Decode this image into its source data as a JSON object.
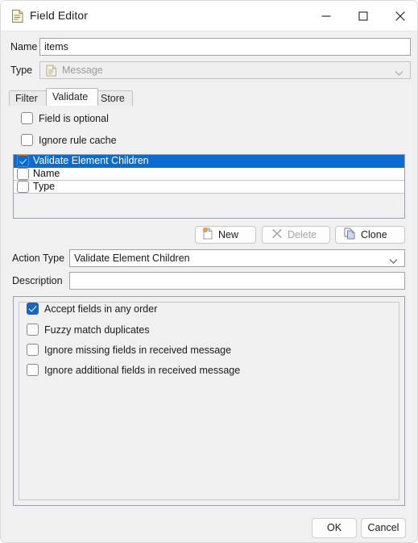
{
  "window": {
    "title": "Field Editor",
    "icon": "document-icon",
    "controls": {
      "minimize": "minimize-icon",
      "maximize": "maximize-icon",
      "close": "close-icon"
    }
  },
  "form": {
    "name_label": "Name",
    "name_value": "items",
    "type_label": "Type",
    "type_value": "Message",
    "type_icon": "document-icon",
    "type_disabled": true
  },
  "tabs": [
    {
      "label": "Filter",
      "active": false
    },
    {
      "label": "Validate",
      "active": true
    },
    {
      "label": "Store",
      "active": false
    }
  ],
  "options": [
    {
      "label": "Field is optional",
      "checked": false
    },
    {
      "label": "Ignore rule cache",
      "checked": false
    }
  ],
  "rules_list": [
    {
      "label": "Validate Element Children",
      "checked": true,
      "selected": true
    },
    {
      "label": "Name",
      "checked": false,
      "selected": false
    },
    {
      "label": "Type",
      "checked": false,
      "selected": false
    }
  ],
  "list_buttons": [
    {
      "label": "New",
      "icon": "new-document-icon",
      "disabled": false
    },
    {
      "label": "Delete",
      "icon": "delete-x-icon",
      "disabled": true
    },
    {
      "label": "Clone",
      "icon": "clone-documents-icon",
      "disabled": false
    }
  ],
  "action": {
    "type_label": "Action Type",
    "type_value": "Validate Element Children",
    "description_label": "Description",
    "description_value": "",
    "description_placeholder": ""
  },
  "action_options": [
    {
      "label": "Accept fields in any order",
      "checked": true
    },
    {
      "label": "Fuzzy match duplicates",
      "checked": false
    },
    {
      "label": "Ignore missing fields in received message",
      "checked": false
    },
    {
      "label": "Ignore additional fields in received message",
      "checked": false
    }
  ],
  "dialog_buttons": [
    {
      "label": "OK"
    },
    {
      "label": "Cancel"
    }
  ],
  "colors": {
    "selection_blue": "#0a6cd0",
    "checkbox_blue": "#1266c4",
    "window_bg": "#f0f0f0",
    "field_bg": "#ffffff"
  }
}
